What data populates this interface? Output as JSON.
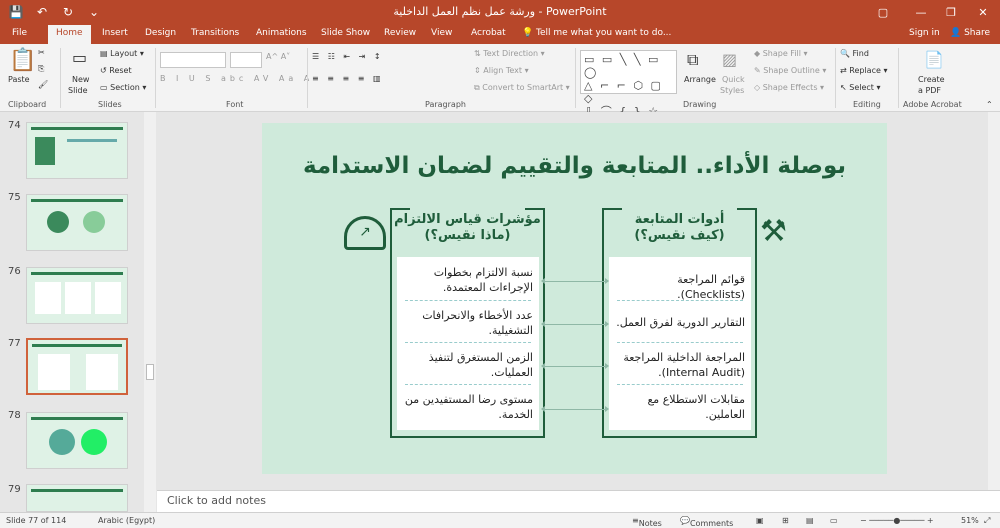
{
  "window": {
    "title": "ورشة عمل نظم العمل الداخلية - PowerPoint"
  },
  "tabs": [
    "File",
    "Home",
    "Insert",
    "Design",
    "Transitions",
    "Animations",
    "Slide Show",
    "Review",
    "View",
    "Acrobat"
  ],
  "tell_me": "Tell me what you want to do...",
  "account": {
    "sign_in": "Sign in",
    "share": "Share"
  },
  "ribbon": {
    "clipboard": {
      "paste": "Paste",
      "label": "Clipboard"
    },
    "slides": {
      "new_slide_1": "New",
      "new_slide_2": "Slide",
      "layout": "Layout",
      "reset": "Reset",
      "section": "Section",
      "label": "Slides"
    },
    "font": {
      "label": "Font"
    },
    "paragraph": {
      "text_direction": "Text Direction",
      "align_text": "Align Text",
      "convert": "Convert to SmartArt",
      "label": "Paragraph"
    },
    "drawing": {
      "arrange": "Arrange",
      "quick_styles_1": "Quick",
      "quick_styles_2": "Styles",
      "shape_fill": "Shape Fill",
      "shape_outline": "Shape Outline",
      "shape_effects": "Shape Effects",
      "label": "Drawing"
    },
    "editing": {
      "find": "Find",
      "replace": "Replace",
      "select": "Select",
      "label": "Editing"
    },
    "acrobat": {
      "create_pdf_1": "Create",
      "create_pdf_2": "a PDF",
      "label": "Adobe Acrobat"
    }
  },
  "thumbnails": [
    {
      "num": "74"
    },
    {
      "num": "75"
    },
    {
      "num": "76"
    },
    {
      "num": "77"
    },
    {
      "num": "78"
    },
    {
      "num": "79"
    }
  ],
  "slide": {
    "title": "بوصلة الأداء.. المتابعة والتقييم لضمان الاستدامة",
    "right_col": {
      "head1": "أدوات المتابعة",
      "head2": "(كيف نقيس؟)",
      "items": [
        "قوائم المراجعة (Checklists).",
        "التقارير الدورية لفرق العمل.",
        "المراجعة الداخلية المراجعة (Internal Audit).",
        "مقابلات الاستطلاع مع العاملين."
      ]
    },
    "left_col": {
      "head1": "مؤشرات قياس الالتزام",
      "head2": "(ماذا نقيس؟)",
      "items": [
        "نسبة الالتزام بخطوات الإجراءات المعتمدة.",
        "عدد الأخطاء والانحرافات التشغيلية.",
        "الزمن المستغرق لتنفيذ العمليات.",
        "مستوى رضا المستفيدين من الخدمة."
      ]
    }
  },
  "notes_placeholder": "Click to add notes",
  "status": {
    "slide": "Slide 77 of 114",
    "lang": "Arabic (Egypt)",
    "notes": "Notes",
    "comments": "Comments",
    "zoom": "51%"
  },
  "colors": {
    "accent": "#b7472a",
    "slide_green": "#1f5d3b",
    "slide_bg": "#cfeadb"
  }
}
